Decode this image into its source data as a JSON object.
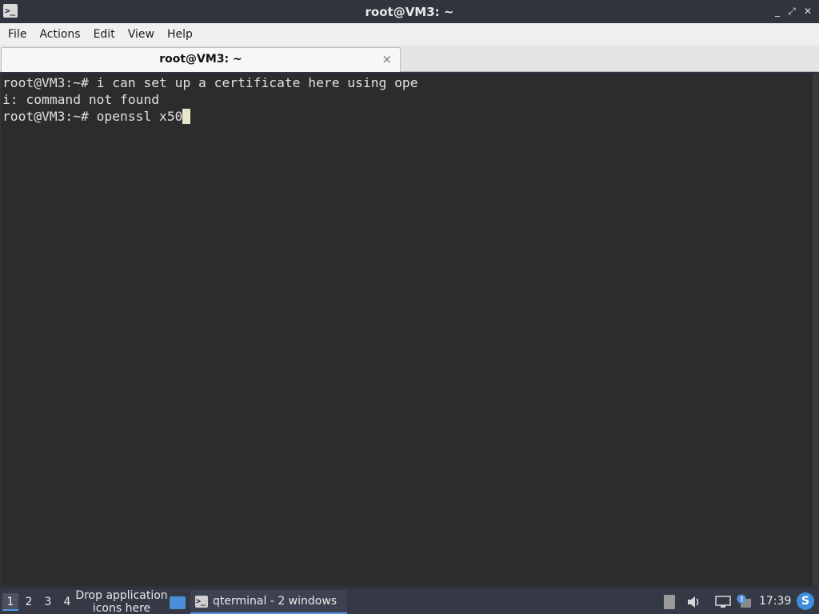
{
  "window": {
    "title": "root@VM3: ~",
    "app_icon": "terminal-icon",
    "buttons": {
      "minimize": "_",
      "maximize": "⤢",
      "close": "✕"
    }
  },
  "menu": {
    "items": [
      "File",
      "Actions",
      "Edit",
      "View",
      "Help"
    ]
  },
  "tabs": [
    {
      "label": "root@VM3: ~",
      "close": "×"
    }
  ],
  "terminal": {
    "lines": [
      "root@VM3:~# i can set up a certificate here using ope",
      "i: command not found",
      "root@VM3:~# openssl x50"
    ],
    "colors": {
      "background": "#2c2c2c",
      "foreground": "#e0e0e0",
      "cursor": "#e8e6c9"
    }
  },
  "taskbar": {
    "workspaces": [
      "1",
      "2",
      "3",
      "4"
    ],
    "active_workspace": "1",
    "quicklaunch_text_line1": "Drop application",
    "quicklaunch_text_line2": "icons here",
    "task_label": "qterminal - 2 windows",
    "tray_icons": [
      "clipboard-icon",
      "volume-icon",
      "network-icon",
      "update-notice-icon"
    ],
    "clock": "17:39",
    "accent": "#5294e2"
  }
}
